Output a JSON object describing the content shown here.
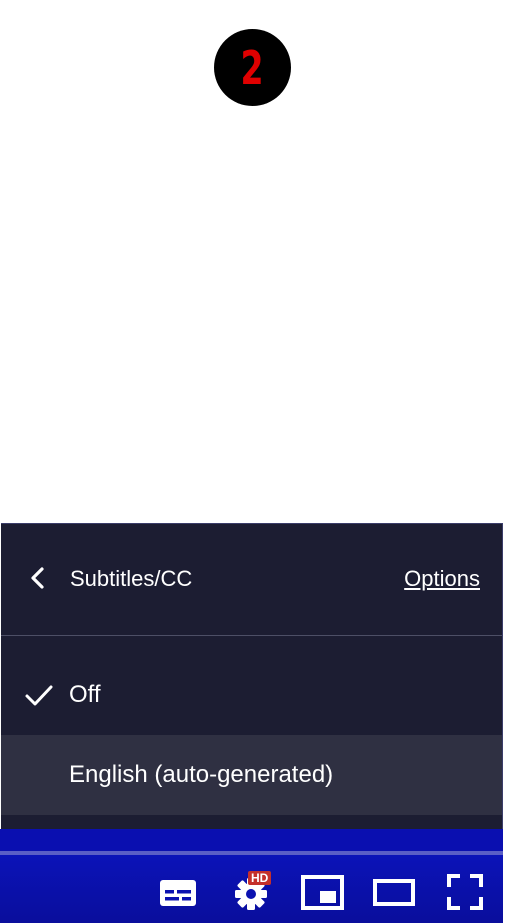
{
  "step_badge": {
    "number": "2",
    "bg_color": "#000000",
    "text_color": "#e00000"
  },
  "menu": {
    "back_icon": "chevron-left-icon",
    "title": "Subtitles/CC",
    "options_label": "Options",
    "items": [
      {
        "label": "Off",
        "selected": true,
        "icon": "check-icon"
      },
      {
        "label": "English (auto-generated)",
        "selected": false,
        "highlighted": true
      }
    ],
    "bg_color": "#1c1d32",
    "highlight_color": "#2f3042"
  },
  "controls": {
    "bar_color": "#0a0fb0",
    "buttons": [
      {
        "name": "subtitles-icon"
      },
      {
        "name": "settings-icon",
        "badge": "HD"
      },
      {
        "name": "miniplayer-icon"
      },
      {
        "name": "theater-mode-icon"
      },
      {
        "name": "fullscreen-icon"
      }
    ]
  }
}
